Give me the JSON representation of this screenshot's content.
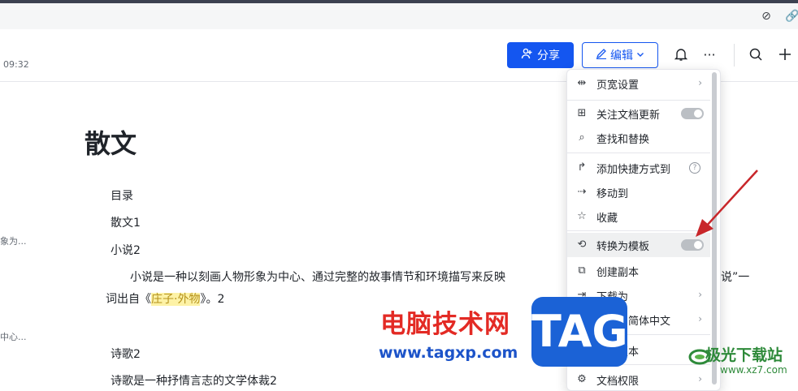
{
  "header": {
    "time": "09:32",
    "share_label": "分享",
    "edit_label": "编辑"
  },
  "doc": {
    "title": "散文",
    "lines": [
      "目录",
      "散文1",
      "小说2"
    ],
    "para1": "小说是一种以刻画人物形象为中心、通过完整的故事情节和环境描写来反映",
    "para1_end": "说”一",
    "para2_pre": "词出自《",
    "para2_hl": "庄子·外物",
    "para2_post": "》。2",
    "line_poem": "诗歌2",
    "line_poem2": "诗歌是一种抒情言志的文学体裁2",
    "side1": "象为...",
    "side2": "中心..."
  },
  "menu": {
    "items": [
      {
        "icon": "page-width-icon",
        "label": "页宽设置"
      },
      {
        "icon": "follow-icon",
        "label": "关注文档更新"
      },
      {
        "icon": "find-replace-icon",
        "label": "查找和替换"
      },
      {
        "icon": "shortcut-icon",
        "label": "添加快捷方式到"
      },
      {
        "icon": "move-icon",
        "label": "移动到"
      },
      {
        "icon": "star-icon",
        "label": "收藏"
      },
      {
        "icon": "template-icon",
        "label": "转换为模板"
      },
      {
        "icon": "copy-icon",
        "label": "创建副本"
      },
      {
        "icon": "download-icon",
        "label": "下载为"
      },
      {
        "icon": "translate-icon",
        "label": "翻译为简体中文"
      },
      {
        "icon": "history-icon",
        "label": "历史版本"
      },
      {
        "icon": "permission-icon",
        "label": "文档权限"
      }
    ]
  },
  "watermark": {
    "site_cn": "电脑技术网",
    "url": "www.tagxp.com",
    "tag": "TAG",
    "logo_cn": "极光下载站",
    "logo_url": "www.xz7.com"
  },
  "colors": {
    "primary": "#1456f0",
    "arrow": "#c8262a",
    "highlight": "#fdf2a6"
  }
}
